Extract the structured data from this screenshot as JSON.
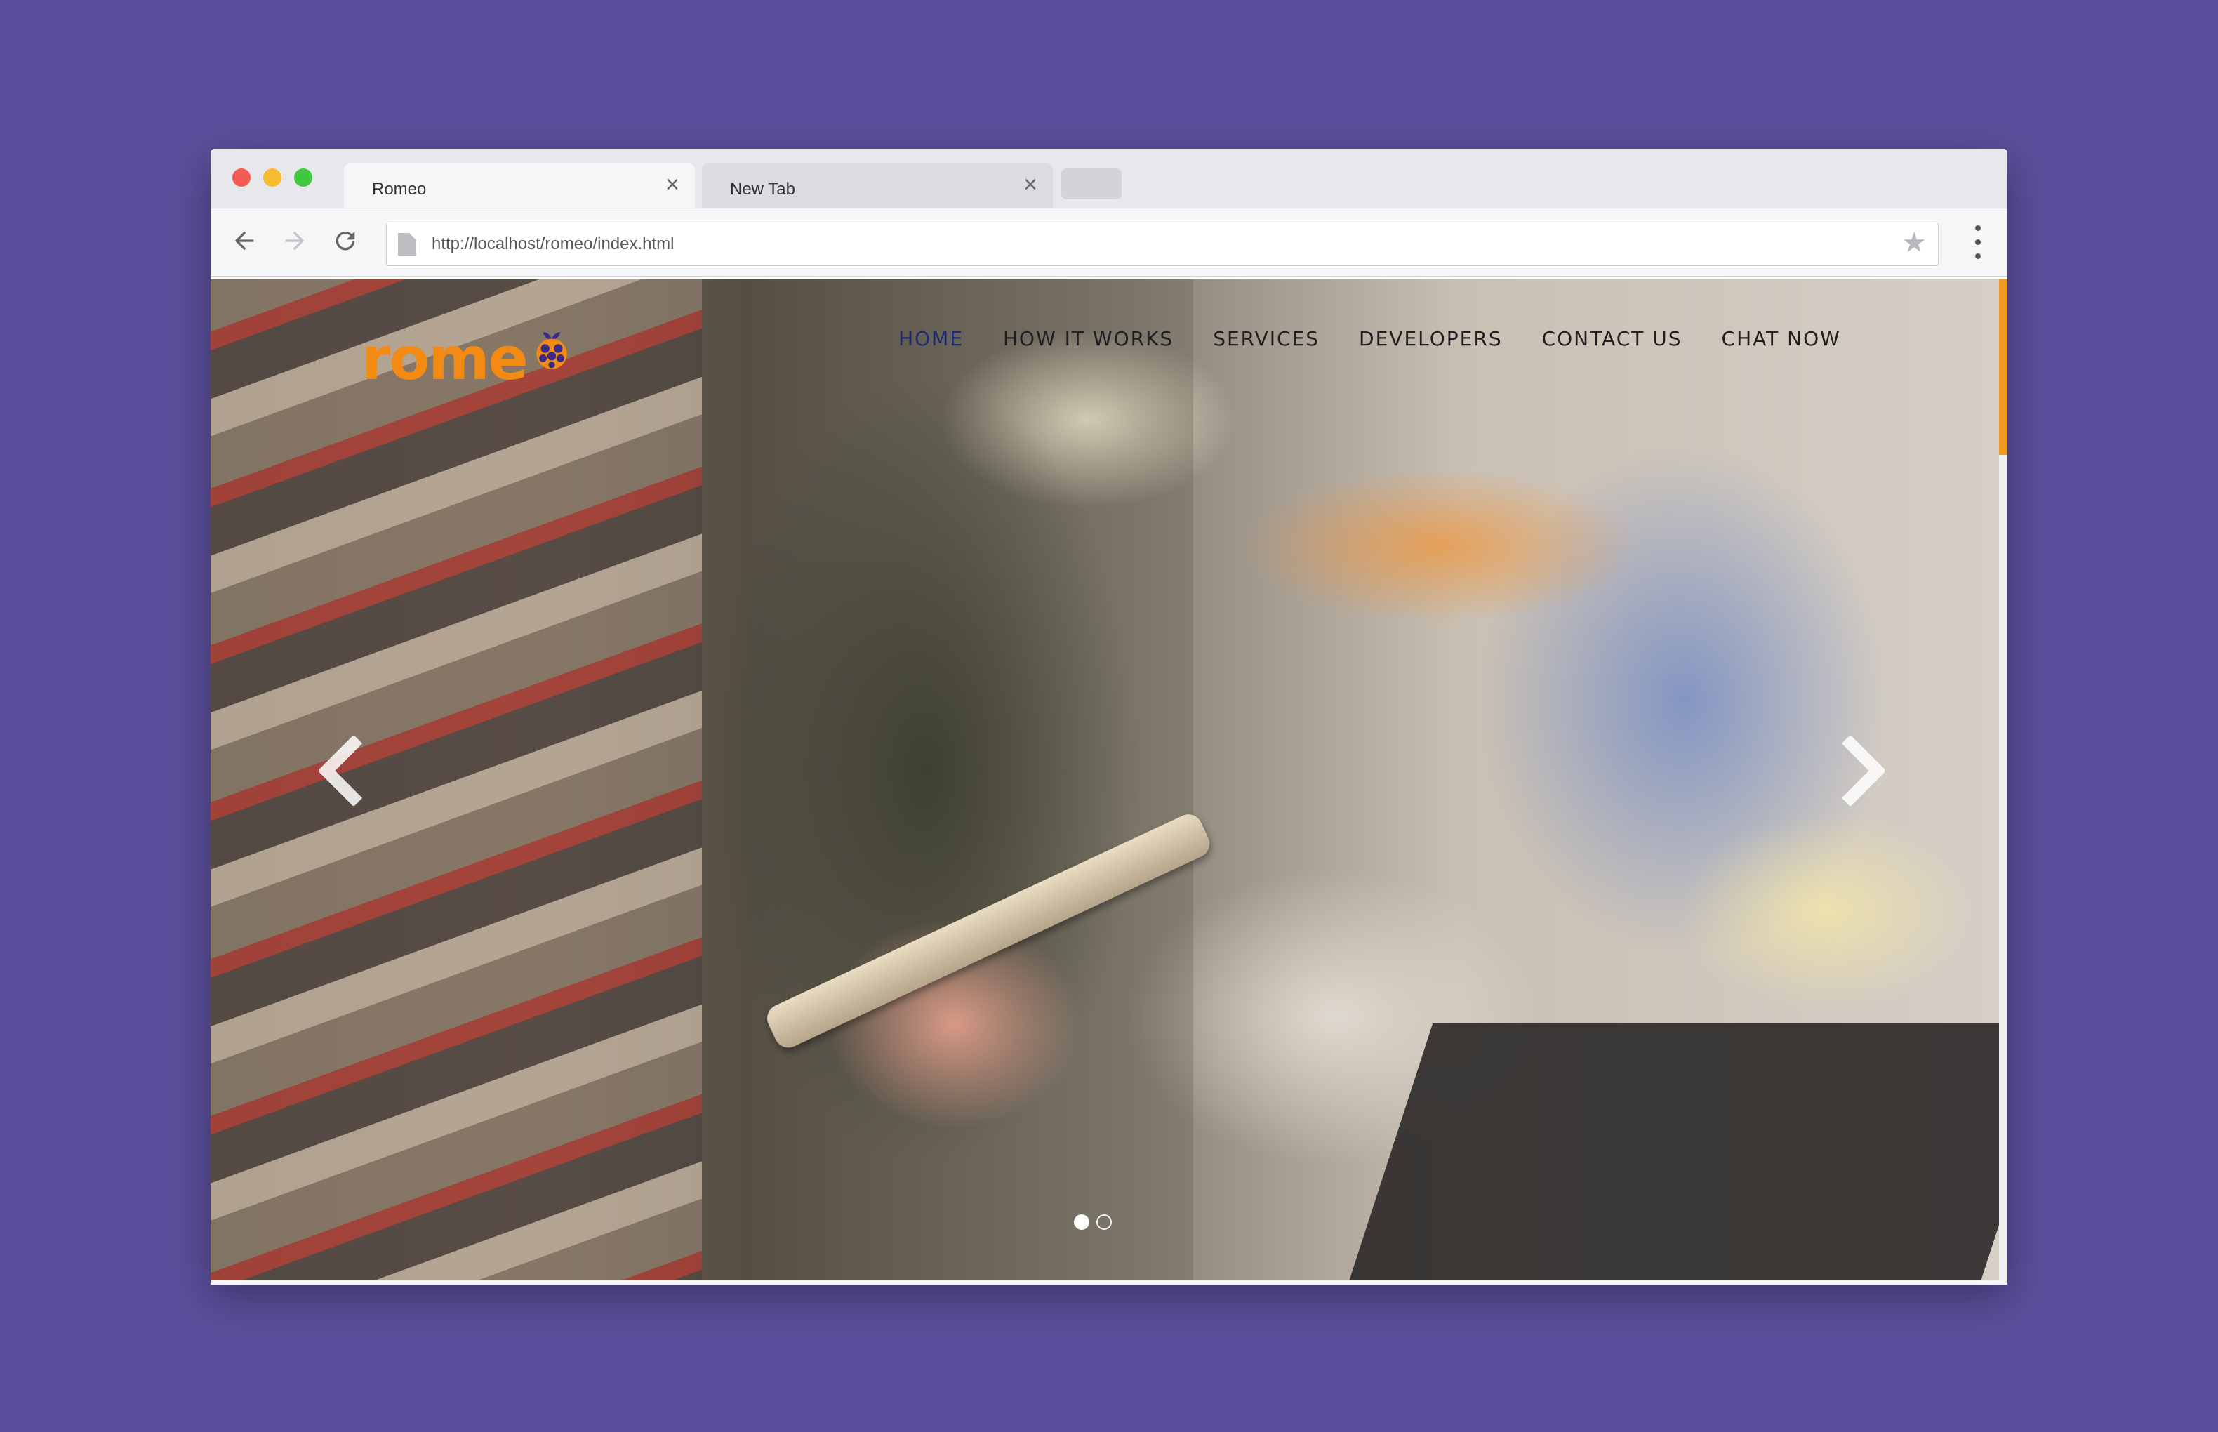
{
  "browser": {
    "tabs": [
      {
        "title": "Romeo",
        "close": "×",
        "active": true
      },
      {
        "title": "New Tab",
        "close": "×",
        "active": false
      }
    ],
    "url": "http://localhost/romeo/index.html",
    "icons": {
      "back": "arrow-left-icon",
      "forward": "arrow-right-icon",
      "reload": "reload-icon",
      "page": "page-icon",
      "bookmark": "star-icon",
      "menu": "kebab-menu-icon"
    }
  },
  "site": {
    "logo_text": "rome",
    "logo_icon": "raspberry-icon",
    "nav": [
      "HOME",
      "HOW IT WORKS",
      "SERVICES",
      "DEVELOPERS",
      "CONTACT US",
      "CHAT NOW"
    ],
    "active_nav": "HOME",
    "carousel": {
      "prev_icon": "chevron-left-icon",
      "next_icon": "chevron-right-icon",
      "slides": 2,
      "current_slide": 1
    }
  },
  "colors": {
    "background": "#5a4f9c",
    "accent": "#f28a13",
    "nav_active": "#1d2a6e",
    "scroll_thumb": "#f29a1c"
  }
}
